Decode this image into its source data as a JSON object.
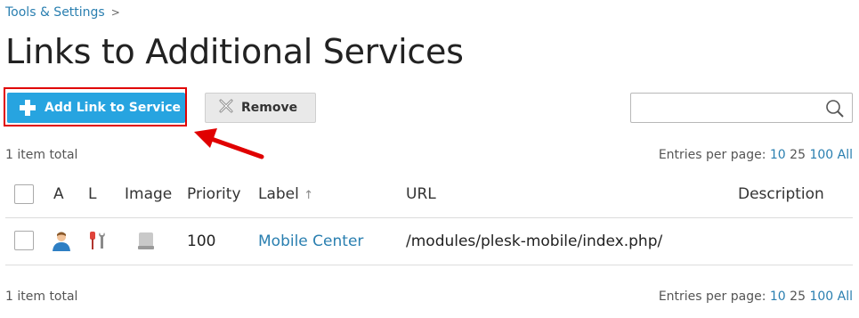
{
  "breadcrumb": {
    "item": "Tools & Settings",
    "separator": ">"
  },
  "page": {
    "title": "Links to Additional Services"
  },
  "toolbar": {
    "add_label": "Add Link to Service",
    "remove_label": "Remove",
    "search_placeholder": ""
  },
  "summary": {
    "total_text": "1 item total",
    "entries_label": "Entries per page:",
    "options": [
      "10",
      "25",
      "100",
      "All"
    ]
  },
  "table": {
    "headers": {
      "a": "A",
      "l": "L",
      "image": "Image",
      "priority": "Priority",
      "label": "Label",
      "sort_arrow": "↑",
      "url": "URL",
      "description": "Description"
    },
    "rows": [
      {
        "priority": "100",
        "label": "Mobile Center",
        "url": "/modules/plesk-mobile/index.php/",
        "description": ""
      }
    ]
  },
  "colors": {
    "accent": "#27a4e0",
    "link": "#2a7fb0",
    "highlight": "#e00000"
  },
  "icons": [
    "chevron-right-icon",
    "plus-icon",
    "remove-x-icon",
    "search-icon",
    "user-icon",
    "tools-icon",
    "image-placeholder-icon",
    "sort-arrow-icon"
  ]
}
